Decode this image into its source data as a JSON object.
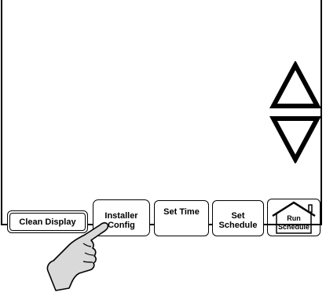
{
  "buttons": {
    "clean_display": "Clean Display",
    "installer_config_line1": "Installer",
    "installer_config_line2": "Config",
    "set_time": "Set Time",
    "set_schedule_line1": "Set",
    "set_schedule_line2": "Schedule",
    "run_schedule_line1": "Run",
    "run_schedule_line2": "Schedule"
  },
  "icons": {
    "up": "up-arrow-icon",
    "down": "down-arrow-icon",
    "home": "house-icon",
    "pointer": "pointing-hand-icon"
  }
}
